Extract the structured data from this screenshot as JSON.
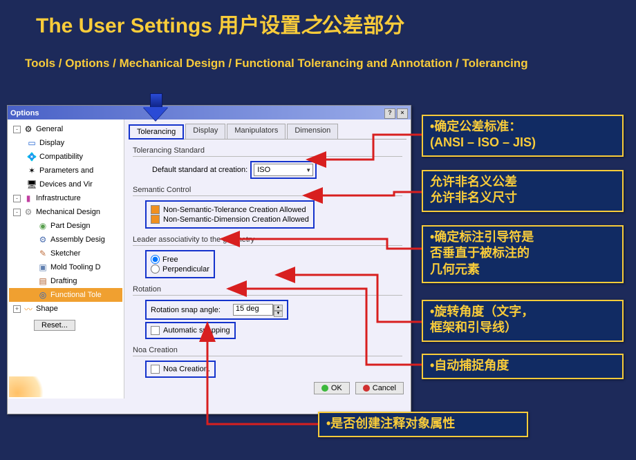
{
  "slide": {
    "title_en": "The User Settings ",
    "title_cn_1": "用户设置",
    "title_cn_italic": "之",
    "title_cn_2": "公差部分",
    "path": "Tools / Options / Mechanical Design / Functional Tolerancing and Annotation / Tolerancing"
  },
  "dialog": {
    "title": "Options",
    "help": "?",
    "close": "×"
  },
  "tree": {
    "general": "General",
    "display": "Display",
    "compatibility": "Compatibility",
    "parameters": "Parameters and",
    "devices": "Devices and Vir",
    "infrastructure": "Infrastructure",
    "mechdesign": "Mechanical Design",
    "partdesign": "Part Design",
    "assembly": "Assembly Desig",
    "sketcher": "Sketcher",
    "mold": "Mold Tooling D",
    "drafting": "Drafting",
    "fta": "Functional Tole",
    "shape": "Shape",
    "reset": "Reset..."
  },
  "tabs": {
    "tolerancing": "Tolerancing",
    "display": "Display",
    "manipulators": "Manipulators",
    "dimension": "Dimension"
  },
  "panel": {
    "std_group": "Tolerancing Standard",
    "std_label": "Default standard at creation:",
    "std_value": "ISO",
    "sem_group": "Semantic Control",
    "sem_tol": "Non-Semantic-Tolerance Creation Allowed",
    "sem_dim": "Non-Semantic-Dimension Creation Allowed",
    "leader_group": "Leader associativity to the geometry",
    "leader_free": "Free",
    "leader_perp": "Perpendicular",
    "rot_group": "Rotation",
    "rot_label": "Rotation snap angle:",
    "rot_value": "15 deg",
    "rot_auto": "Automatic snapping",
    "noa_group": "Noa Creation",
    "noa_opt": "Noa Creation.",
    "ok": "OK",
    "cancel": "Cancel"
  },
  "notes": {
    "n1a": "•确定公差标准：",
    "n1b": "(ANSI – ISO – JIS)",
    "n2a": "允许非名义公差",
    "n2b": "允许非名义尺寸",
    "n3a": "•确定标注引导符是",
    "n3b": "否垂直于被标注的",
    "n3c": "几何元素",
    "n4a": "•旋转角度（文字，",
    "n4b": "框架和引导线）",
    "n5": "•自动捕捉角度",
    "n6": "•是否创建注释对象属性"
  }
}
